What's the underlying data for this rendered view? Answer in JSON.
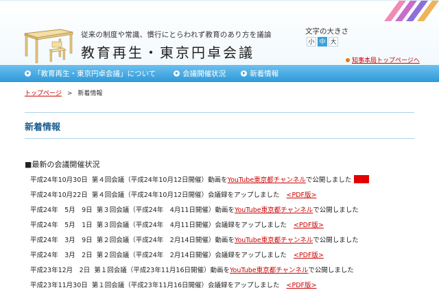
{
  "header": {
    "tagline": "従来の制度や常識、慣行にとらわれず教育のあり方を議論",
    "site_title": "教育再生・東京円卓会議",
    "fontsize_label": "文字の大きさ",
    "fontsize_buttons": [
      "小",
      "中",
      "大"
    ],
    "governor_link": "知事本局トップページへ"
  },
  "nav": {
    "items": [
      "「教育再生・東京円卓会議」について",
      "会議開催状況",
      "新着情報"
    ]
  },
  "breadcrumb": {
    "home": "トップページ",
    "separator": ">",
    "current": "新着情報"
  },
  "page_heading": "新着情報",
  "section_title": "■最新の会議開催状況",
  "news": [
    {
      "date": "平成24年10月30日",
      "meeting": "第４回会議（平成24年10月12日開催）",
      "text1": "動画を",
      "link": "YouTube東京都チャンネル",
      "text2": "で公開しました",
      "new": true
    },
    {
      "date": "平成24年10月22日",
      "meeting": "第４回会議（平成24年10月12日開催）",
      "text1": "会議録をアップしました",
      "link": "<PDF版>",
      "text2": ""
    },
    {
      "date": "平成24年　5月　9日",
      "meeting": "第３回会議（平成24年　4月11日開催）",
      "text1": "動画を",
      "link": "YouTube東京都チャンネル",
      "text2": "で公開しました"
    },
    {
      "date": "平成24年　5月　1日",
      "meeting": "第３回会議（平成24年　4月11日開催）",
      "text1": "会議録をアップしました",
      "link": "<PDF版>",
      "text2": ""
    },
    {
      "date": "平成24年　3月　9日",
      "meeting": "第２回会議（平成24年　2月14日開催）",
      "text1": "動画を",
      "link": "YouTube東京都チャンネル",
      "text2": "で公開しました"
    },
    {
      "date": "平成24年　3月　2日",
      "meeting": "第２回会議（平成24年　2月14日開催）",
      "text1": "会議録をアップしました",
      "link": "<PDF版>",
      "text2": ""
    },
    {
      "date": "平成23年12月　2日",
      "meeting": "第１回会議（平成23年11月16日開催）",
      "text1": "動画を",
      "link": "YouTube東京都チャンネル",
      "text2": "で公開しました"
    },
    {
      "date": "平成23年11月30日",
      "meeting": "第１回会議（平成23年11月16日開催）",
      "text1": "会議録をアップしました",
      "link": "<PDF版>",
      "text2": ""
    }
  ],
  "colors": {
    "nav_blue": "#2e99d8",
    "heading_blue": "#1c5f8e",
    "link_red": "#cc0000",
    "new_badge": "#e30000"
  }
}
